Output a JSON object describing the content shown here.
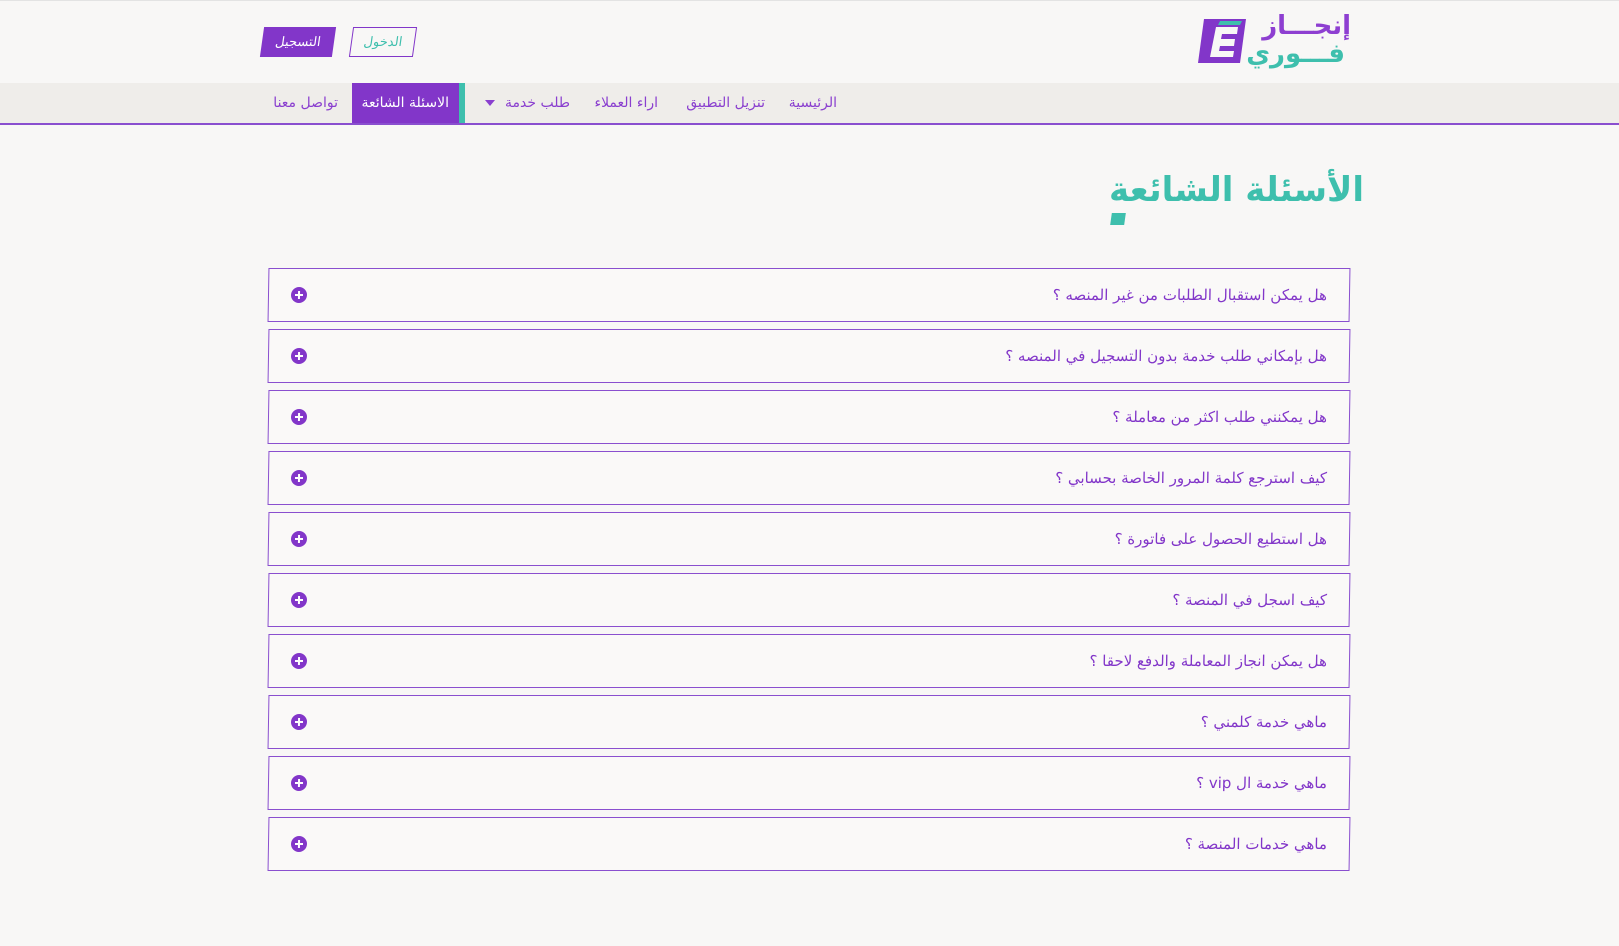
{
  "header": {
    "logo": {
      "line1": "إنجـــاز",
      "line2": "فـــوري",
      "mark_letter": "E"
    },
    "register_label": "التسجيل",
    "login_label": "الدخول"
  },
  "nav": {
    "items": [
      {
        "label": "الرئيسية"
      },
      {
        "label": "تنزيل التطبيق"
      },
      {
        "label": "اراء العملاء"
      },
      {
        "label": "طلب خدمة"
      },
      {
        "label": "الاسئلة الشائعة"
      },
      {
        "label": "تواصل معنا"
      }
    ]
  },
  "page": {
    "title": "الأسئلة الشائعة"
  },
  "faq": [
    {
      "q": "هل يمكن استقبال الطلبات من غير المنصه ؟"
    },
    {
      "q": "هل بإمكاني طلب خدمة بدون التسجيل في المنصه ؟"
    },
    {
      "q": "هل يمكنني طلب اكثر من معاملة ؟"
    },
    {
      "q": "كيف استرجع كلمة المرور الخاصة بحسابي ؟"
    },
    {
      "q": "هل استطيع الحصول على فاتورة ؟"
    },
    {
      "q": "كيف اسجل في المنصة ؟"
    },
    {
      "q": "هل يمكن انجاز المعاملة والدفع لاحقا ؟"
    },
    {
      "q": "ماهي خدمة كلمني ؟"
    },
    {
      "q": "ماهي خدمة ال vip ؟"
    },
    {
      "q": "ماهي خدمات المنصة ؟"
    }
  ],
  "colors": {
    "brand_purple": "#8236c9",
    "brand_teal": "#3ebfad",
    "background": "#f8f7f6"
  },
  "icons": {
    "logo": "e-logo-icon",
    "expand": "plus-circle-icon",
    "dropdown": "caret-down-icon"
  }
}
